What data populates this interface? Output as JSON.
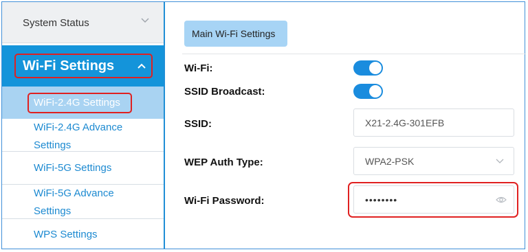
{
  "sidebar": {
    "system_status": "System Status",
    "wifi_settings": "Wi-Fi Settings",
    "items": [
      {
        "label": "WiFi-2.4G Settings",
        "active": true
      },
      {
        "label": "WiFi-2.4G Advance Settings"
      },
      {
        "label": "WiFi-5G Settings"
      },
      {
        "label": "WiFi-5G Advance Settings"
      },
      {
        "label": "WPS Settings"
      }
    ]
  },
  "main": {
    "tab": "Main Wi-Fi Settings",
    "wifi_label": "Wi-Fi:",
    "wifi_enabled": true,
    "ssid_broadcast_label": "SSID Broadcast:",
    "ssid_broadcast_enabled": true,
    "ssid_label": "SSID:",
    "ssid_value": "X21-2.4G-301EFB",
    "auth_label": "WEP Auth Type:",
    "auth_value": "WPA2-PSK",
    "password_label": "Wi-Fi Password:",
    "password_value": "••••••••"
  },
  "colors": {
    "accent": "#1494da",
    "active_sub": "#a9d3f2",
    "toggle_on": "#1a8cde",
    "highlight": "#e02020",
    "link": "#1d8ad1"
  },
  "icons": [
    "chevron-down-icon",
    "chevron-up-icon",
    "eye-icon"
  ]
}
